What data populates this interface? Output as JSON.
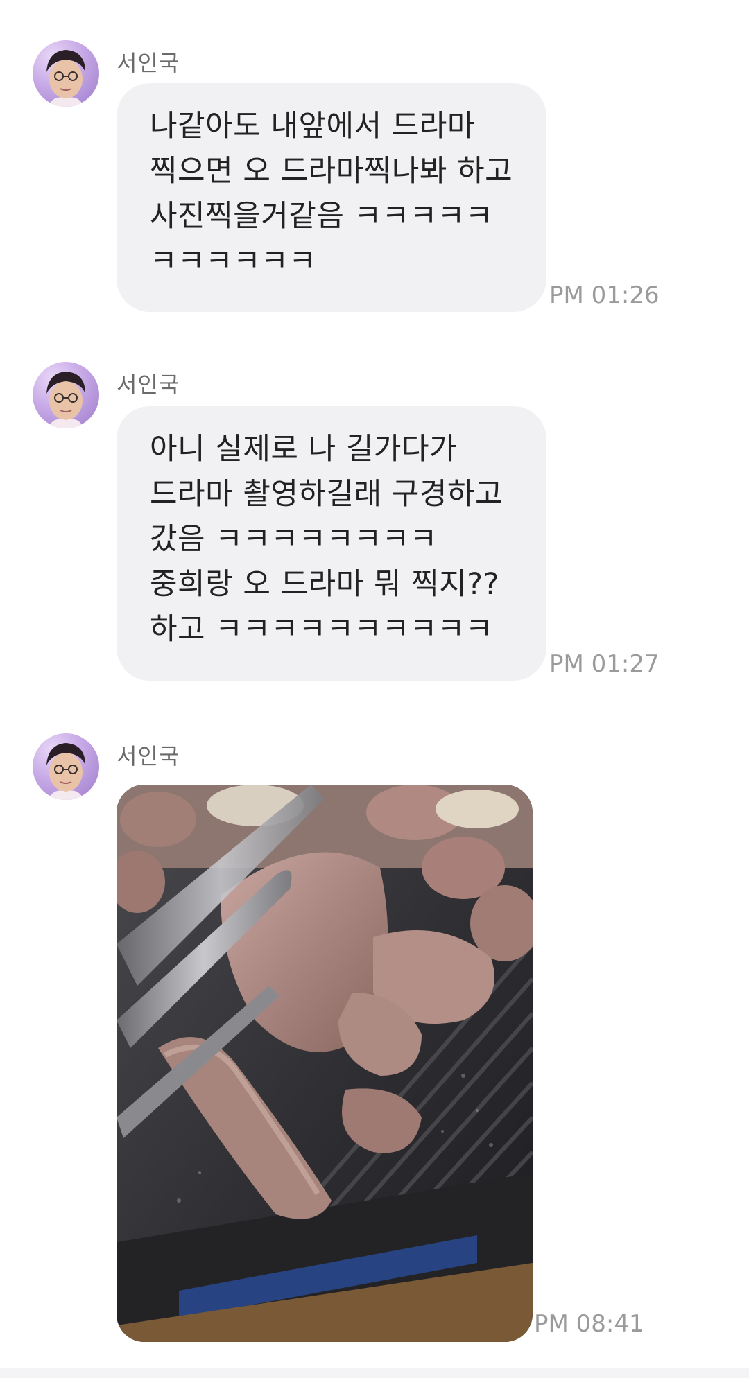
{
  "messages": [
    {
      "sender": "서인국",
      "lines": [
        "나같아도 내앞에서 드라마",
        "찍으면 오 드라마찍나봐 하고",
        "사진찍을거같음 ㅋㅋㅋㅋㅋ",
        "ㅋㅋㅋㅋㅋㅋ"
      ],
      "time": "PM 01:26"
    },
    {
      "sender": "서인국",
      "lines": [
        "아니 실제로 나 길가다가",
        "드라마 촬영하길래 구경하고",
        "갔음 ㅋㅋㅋㅋㅋㅋㅋㅋ",
        "중희랑 오 드라마 뭐 찍지??",
        "하고 ㅋㅋㅋㅋㅋㅋㅋㅋㅋㅋ"
      ],
      "time": "PM 01:27"
    },
    {
      "sender": "서인국",
      "photo": "grilled-pork-photo",
      "time": "PM 08:41"
    }
  ],
  "colors": {
    "bubble": "#f1f1f3",
    "sender": "#6a6a6a",
    "timestamp": "#9a9a9a"
  }
}
